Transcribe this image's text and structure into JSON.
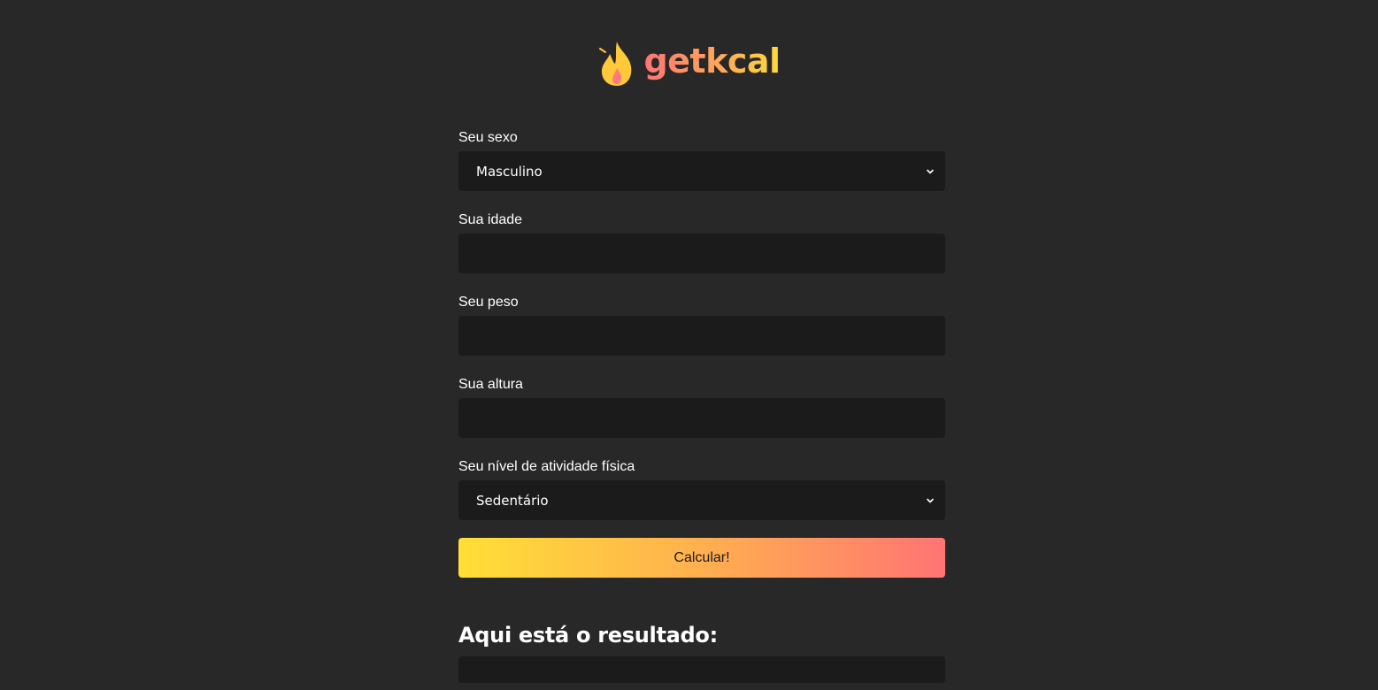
{
  "header": {
    "logo_text": "getkcal",
    "logo_icon": "flame-icon",
    "colors": {
      "flame_outer": "#ffc93a",
      "flame_inner": "#ff7a7a",
      "text_gradient_start": "#ff7474",
      "text_gradient_end": "#ffd93a"
    }
  },
  "form": {
    "sex": {
      "label": "Seu sexo",
      "selected": "Masculino"
    },
    "age": {
      "label": "Sua idade",
      "value": ""
    },
    "weight": {
      "label": "Seu peso",
      "value": ""
    },
    "height": {
      "label": "Sua altura",
      "value": ""
    },
    "activity": {
      "label": "Seu nível de atividade física",
      "selected": "Sedentário"
    },
    "submit_label": "Calcular!",
    "submit_gradient": [
      "#ffdf36",
      "#ff7474"
    ]
  },
  "result": {
    "title": "Aqui está o resultado:",
    "value": ""
  },
  "theme": {
    "background": "#282828",
    "field_background": "#1b1b1b"
  }
}
